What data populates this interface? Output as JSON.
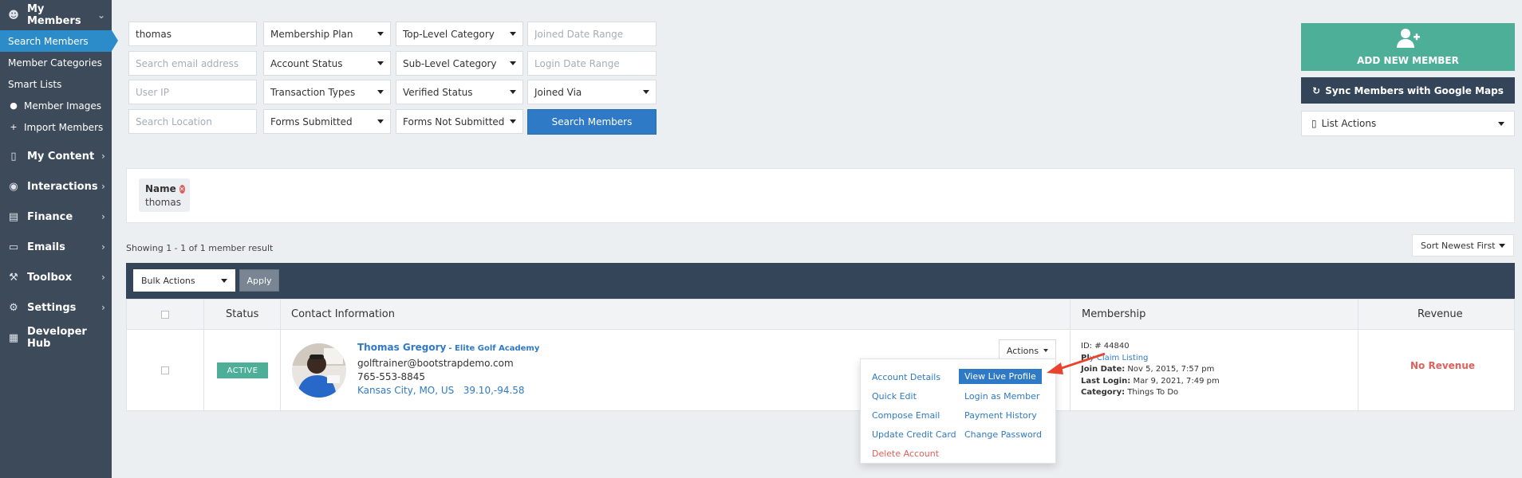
{
  "sidebar": {
    "sections": [
      {
        "label": "My Members",
        "icon": "users-icon"
      },
      {
        "label": "My Content",
        "icon": "folder-icon"
      },
      {
        "label": "Interactions",
        "icon": "comments-icon"
      },
      {
        "label": "Finance",
        "icon": "money-icon"
      },
      {
        "label": "Emails",
        "icon": "inbox-icon"
      },
      {
        "label": "Toolbox",
        "icon": "wrench-icon"
      },
      {
        "label": "Settings",
        "icon": "gear-icon"
      },
      {
        "label": "Developer Hub",
        "icon": "grid-icon"
      }
    ],
    "member_items": [
      {
        "label": "Search Members"
      },
      {
        "label": "Member Categories"
      },
      {
        "label": "Smart Lists"
      },
      {
        "label": "Member Images"
      },
      {
        "label": "Import Members"
      }
    ]
  },
  "filters": {
    "name_value": "thomas",
    "email_placeholder": "Search email address",
    "ip_placeholder": "User IP",
    "location_placeholder": "Search Location",
    "membership_plan": "Membership Plan",
    "account_status": "Account Status",
    "transaction_types": "Transaction Types",
    "forms_submitted": "Forms Submitted",
    "top_level_category": "Top-Level Category",
    "sub_level_category": "Sub-Level Category",
    "verified_status": "Verified Status",
    "forms_not_submitted": "Forms Not Submitted",
    "joined_date_placeholder": "Joined Date Range",
    "login_date_placeholder": "Login Date Range",
    "joined_via": "Joined Via",
    "search_button": "Search Members"
  },
  "right_panel": {
    "add_member": "ADD NEW MEMBER",
    "sync": "Sync Members with Google Maps",
    "list_actions": "List Actions"
  },
  "active_filter": {
    "key": "Name",
    "value": "thomas"
  },
  "results": {
    "showing": "Showing 1 - 1 of 1 member result",
    "sort": "Sort Newest First",
    "bulk_actions": "Bulk Actions",
    "apply": "Apply"
  },
  "table": {
    "headers": [
      "Status",
      "Contact Information",
      "Membership",
      "Revenue"
    ],
    "row": {
      "status": "ACTIVE",
      "name": "Thomas Gregory",
      "company": "- Elite Golf Academy",
      "email": "golftrainer@bootstrapdemo.com",
      "phone": "765-553-8845",
      "location": "Kansas City, MO, US",
      "coords": "39.10,-94.58",
      "actions": "Actions",
      "id_label": "ID: #",
      "id_value": "44840",
      "plan_label": "Pl",
      "plan_value": "y Claim Listing",
      "join_label": "Join Date:",
      "join_value": "Nov 5, 2015, 7:57 pm",
      "login_label": "Last Login:",
      "login_value": "Mar 9, 2021, 7:49 pm",
      "category_label": "Category:",
      "category_value": "Things To Do",
      "revenue": "No Revenue"
    }
  },
  "actions_menu": {
    "account_details": "Account Details",
    "view_live_profile": "View Live Profile",
    "quick_edit": "Quick Edit",
    "login_as_member": "Login as Member",
    "compose_email": "Compose Email",
    "payment_history": "Payment History",
    "update_credit_card": "Update Credit Card",
    "change_password": "Change Password",
    "delete_account": "Delete Account"
  },
  "colors": {
    "sidebar": "#3d4a5a",
    "accent_blue": "#2f7ac6",
    "active_green": "#4daf98",
    "dark_bar": "#344559",
    "danger": "#e0605b",
    "arrow": "#e8442d"
  }
}
